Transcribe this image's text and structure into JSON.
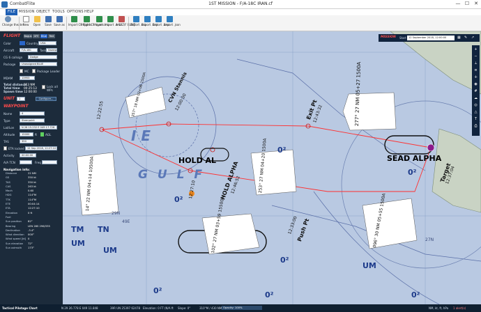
{
  "window": {
    "app_name": "CombatFlite",
    "title": "1ST MISSION - F/A-18C IRAN.cf",
    "minimize": "—",
    "maximize": "☐",
    "close": "✕"
  },
  "menu": [
    "FILE",
    "MISSION",
    "OBJECT",
    "TOOLS",
    "OPTIONS",
    "HELP"
  ],
  "ribbon": {
    "buttons": [
      {
        "label": "Change theater",
        "color": "#6b8fb8"
      },
      {
        "label": "New",
        "color": "#ffffff"
      },
      {
        "label": "Open",
        "color": "#f2c24b"
      },
      {
        "label": "Save",
        "color": "#3f6fb0"
      },
      {
        "label": "Save as",
        "color": "#3f6fb0"
      },
      {
        "label": "Import CF flights",
        "color": "#2f8f4b"
      },
      {
        "label": "Import CF layers",
        "color": "#2f8f4b"
      },
      {
        "label": "Import .miz",
        "color": "#2f8f4b"
      },
      {
        "label": "Import .amz",
        "color": "#2f8f4b"
      },
      {
        "label": "A-10Z/F ELINT",
        "color": "#c05050"
      },
      {
        "label": "Export .miz",
        "color": "#2f7fc0"
      },
      {
        "label": "Export .kml",
        "color": "#2f7fc0"
      },
      {
        "label": "Export .amz",
        "color": "#2f7fc0"
      },
      {
        "label": "Export .json",
        "color": "#2f7fc0"
      }
    ]
  },
  "panel": {
    "flight_heading": "FLIGHT",
    "coalitions": [
      "Bogus",
      "GFE",
      "Blue",
      "Red"
    ],
    "color_label": "Color",
    "country_label": "Country",
    "country_value": "USA",
    "aircraft_label": "Aircraft",
    "aircraft_value": "F/A-18C",
    "task_label": "Task",
    "task_value": "Sweep",
    "callsign_label": "CG 6 callsign",
    "callsign_value": "Dodge",
    "package_label": "Package",
    "package_value": "Unassigned BLUE",
    "mc_label": "MC",
    "pkg_leader_label": "Package Leader",
    "mdam_label": "MDAM",
    "mdam_value": "13953",
    "total_distance_label": "Total distance",
    "total_distance_value": "153 NM",
    "total_time_label": "Total time",
    "total_time_value": "00:25:13",
    "spawn_time_label": "Spawn time",
    "spawn_time_value": "12:00:00",
    "lock_label": "Lock all WPs",
    "unit_heading": "UNIT",
    "unit_value": "1",
    "configure_label": "Configure...",
    "waypoint_heading": "WAYPOINT",
    "name_label": "Name",
    "name_value": "4",
    "type_label": "Type",
    "type_value": "Steerpoint",
    "latlon_label": "Lat/Lon",
    "latlon_value": "N 26 15.232 E 049 17.726",
    "altitude_label": "Altitude",
    "altitude_value": "15000",
    "altitude_unit": "ft",
    "agl_label": "AGL",
    "tas_label": "TAS",
    "tas_value": "350",
    "eta_label": "ETA locked",
    "eta_value": "12 Sep 2018, 12:27:10",
    "activity_label": "Activity",
    "activity_value": "00:00:00",
    "ait_label": "A/A TCN",
    "freq_label": "Freq",
    "nav_heading": "Navigation info:",
    "nav_info": [
      {
        "k": "Distance",
        "v": "22 NM"
      },
      {
        "k": "GS",
        "v": "350 kt"
      },
      {
        "k": "TAS",
        "v": "350 kt"
      },
      {
        "k": "CAS",
        "v": "263 kt"
      },
      {
        "k": "Mach",
        "v": "0.60"
      },
      {
        "k": "HDG",
        "v": "114°M"
      },
      {
        "k": "TTK",
        "v": "114°M"
      },
      {
        "k": "ETE",
        "v": "00:04:14"
      },
      {
        "k": "ETA",
        "v": "12:27:10"
      },
      {
        "k": "Elevation",
        "v": "0 ft"
      },
      {
        "k": "Fuel",
        "v": ""
      },
      {
        "k": "Sun position",
        "v": "82°"
      },
      {
        "k": "Bearing",
        "v": "LEN 28S 296/335"
      },
      {
        "k": "Declination",
        "v": "-3.4°"
      },
      {
        "k": "Wind direction",
        "v": "000°"
      },
      {
        "k": "Wind speed [kt]",
        "v": "0"
      },
      {
        "k": "Sun elevation",
        "v": "72°"
      },
      {
        "k": "Sun azimuth",
        "v": "173°"
      }
    ]
  },
  "map": {
    "mission_title": "MISSION",
    "start_label": "Start",
    "start_value": "12 September 2018, 12:00:00",
    "labels": {
      "gulf_1": "I  E",
      "gulf_2": "G  U  L  F",
      "hold_alpha_big": "HOLD AL",
      "sead_alpha_big": "SEAD ALPHA",
      "cvn_stennis": "CVN Stennis",
      "cvn_time": "12:00:00",
      "hold_alpha_rot": "HOLD ALPHA",
      "hold_time": "12:46:52",
      "exit_pt": "Exit Pt",
      "exit_time": "12:43:32",
      "push_pt": "Push Pt",
      "push_time": "12:33:00",
      "target": "Target",
      "target_time": "12:37:04",
      "wp_time_1": "12:22:55",
      "wp_time_2": "12:27:10",
      "zero_a": "0²",
      "zero_b": "0²",
      "zero_c": "0²",
      "zero_d": "0²",
      "zero_e": "0²",
      "zero_f": "0²",
      "zero_g": "0²",
      "um_1": "UM",
      "um_2": "UM",
      "um_3": "UM",
      "tm": "TM",
      "tn": "TN",
      "e49": "49E",
      "n29": "29N",
      "n27": "27N"
    },
    "cards": [
      {
        "id": "A",
        "leg": "277°",
        "dist": "27 NM",
        "time": "05+27",
        "alt": "1500A"
      },
      {
        "id": "B",
        "leg": "357°",
        "dist": "18 NM",
        "time": "03+06",
        "alt": "1500A"
      },
      {
        "id": "C",
        "leg": "253°",
        "dist": "27 NM",
        "time": "04+20",
        "alt": "1500A"
      },
      {
        "id": "D",
        "leg": "14°",
        "dist": "22 NM",
        "time": "04+14",
        "alt": "10500A"
      },
      {
        "id": "E",
        "leg": "102°",
        "dist": "27 NM",
        "time": "03+59",
        "alt": "15500A"
      },
      {
        "id": "F",
        "leg": "096°",
        "dist": "30 NM",
        "time": "05+55",
        "alt": "1500A"
      }
    ]
  },
  "status": {
    "chart": "Tactical Pilotage Chart",
    "coords": "N 29 26.778  E 049 11.848",
    "mgrs": "39R UN 25397 62478",
    "elevation": "Elevation: 0 FT  (N/A ft",
    "slope": "Slope: 0°",
    "bearing": "310°M / 430 NM",
    "opacity": "Opacity: 100%",
    "scale": "NM, kt, ft, hPa",
    "alerts": "1 alert(s)"
  },
  "colors": {
    "map_water": "#b9c9e2",
    "route": "#ff3030",
    "panel_bg": "#1c2b3b",
    "accent": "#1e5fb4"
  }
}
